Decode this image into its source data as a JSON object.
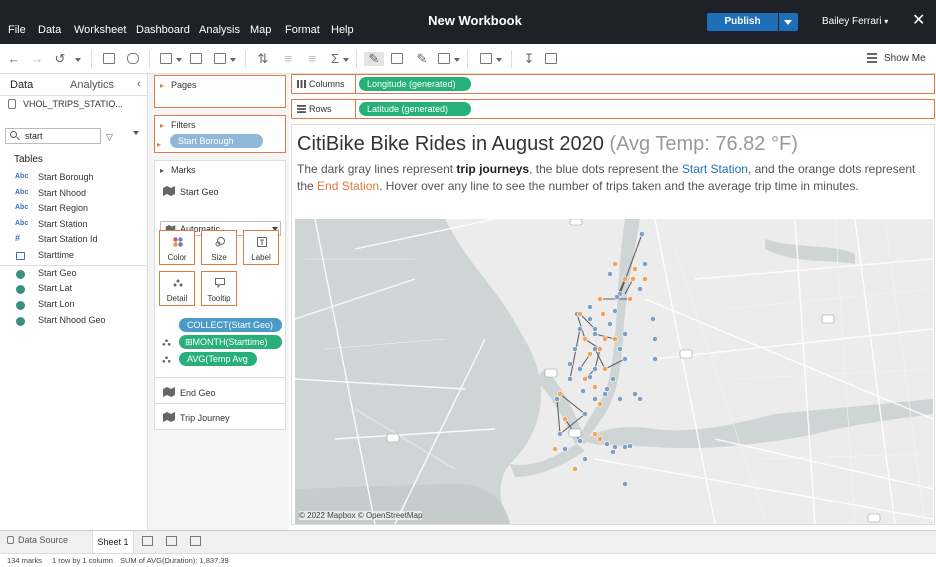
{
  "window": {
    "title": "New Workbook",
    "menu": [
      "File",
      "Data",
      "Worksheet",
      "Dashboard",
      "Analysis",
      "Map",
      "Format",
      "Help"
    ],
    "publish_label": "Publish",
    "user_name": "Bailey Ferrari",
    "user_caret": "▾",
    "close_glyph": "✕"
  },
  "toolbar": {
    "show_me_label": "Show Me"
  },
  "data_pane": {
    "tabs": [
      "Data",
      "Analytics"
    ],
    "collapse_glyph": "‹",
    "datasource": "VHOL_TRIPS_STATIO...",
    "search_value": "start",
    "filter_glyph": "▽",
    "tables_label": "Tables",
    "fields": [
      {
        "type": "Abc",
        "name": "Start Borough"
      },
      {
        "type": "Abc",
        "name": "Start Nhood"
      },
      {
        "type": "Abc",
        "name": "Start Region"
      },
      {
        "type": "Abc",
        "name": "Start Station"
      },
      {
        "type": "#",
        "name": "Start Station Id"
      },
      {
        "type": "date",
        "name": "Starttime"
      },
      {
        "type": "geo",
        "name": "Start Geo"
      },
      {
        "type": "geo",
        "name": "Start Lat"
      },
      {
        "type": "geo",
        "name": "Start Lon"
      },
      {
        "type": "geo",
        "name": "Start Nhood Geo"
      }
    ]
  },
  "cards": {
    "pages_label": "Pages",
    "filters_label": "Filters",
    "filter_pill": "Start Borough",
    "marks_label": "Marks",
    "marks_layer_1": "Start Geo",
    "marks_type": "Automatic",
    "mark_buttons": [
      "Color",
      "Size",
      "Label",
      "Detail",
      "Tooltip"
    ],
    "mark_pills": [
      "COLLECT(Start Geo)",
      "MONTH(Starttime)",
      "AVG(Temp Avg F)"
    ],
    "month_prefix": "⊞",
    "marks_layer_2": "End Geo",
    "marks_layer_3": "Trip Journey"
  },
  "shelves": {
    "columns_label": "Columns",
    "columns_pill": "Longitude (generated)",
    "rows_label": "Rows",
    "rows_pill": "Latitude (generated)"
  },
  "viz": {
    "title_main": "CitiBike Bike Rides in August 2020",
    "title_suffix": "(Avg Temp: 76.82 °F)",
    "desc_1": "The dark gray lines represent ",
    "desc_trip": "trip journeys",
    "desc_2": ", the blue dots represent the ",
    "desc_start": "Start Station",
    "desc_3": ", and the orange dots represent the ",
    "desc_end": "End Station",
    "desc_4": ". Hover over any line to see the number of trips taken and the average trip time in minutes.",
    "attribution": "© 2022 Mapbox  © OpenStreetMap",
    "colors": {
      "start": "#7d9fc8",
      "end": "#f0a45a",
      "line": "#4a4a4a",
      "water": "#cfd4d4",
      "land": "#ececec"
    }
  },
  "bottom": {
    "datasource_tab": "Data Source",
    "sheet_tab": "Sheet 1",
    "status_marks": "134 marks",
    "status_rows": "1 row by 1 column",
    "status_sum": "SUM of AVG(Duration): 1,837.39"
  }
}
